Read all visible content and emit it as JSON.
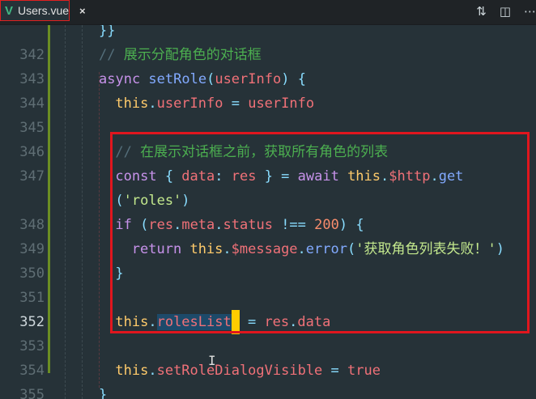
{
  "tab": {
    "icon": "vue-icon",
    "filename": "Users.vue",
    "close": "×"
  },
  "actions": [
    {
      "name": "compare-changes-icon",
      "glyph": "⇅"
    },
    {
      "name": "split-editor-icon",
      "glyph": "◫"
    },
    {
      "name": "more-icon",
      "glyph": "⋯"
    }
  ],
  "current_line": "352",
  "lines": [
    {
      "n": "",
      "indent": 0,
      "t": [
        [
          "pn",
          "}}"
        ]
      ]
    },
    {
      "n": "342",
      "indent": 0,
      "t": [
        [
          "cms",
          "// "
        ],
        [
          "cm",
          "展示分配角色的对话框"
        ]
      ]
    },
    {
      "n": "343",
      "indent": 0,
      "t": [
        [
          "kw",
          "async "
        ],
        [
          "fn",
          "setRole"
        ],
        [
          "pn",
          "("
        ],
        [
          "var",
          "userInfo"
        ],
        [
          "pn",
          ") {"
        ]
      ]
    },
    {
      "n": "344",
      "indent": 2,
      "t": [
        [
          "this",
          "this"
        ],
        [
          "pn",
          "."
        ],
        [
          "var",
          "userInfo"
        ],
        [
          "pn",
          " = "
        ],
        [
          "var",
          "userInfo"
        ]
      ]
    },
    {
      "n": "345",
      "indent": 0,
      "t": []
    },
    {
      "n": "346",
      "indent": 2,
      "t": [
        [
          "cms",
          "// "
        ],
        [
          "cm",
          "在展示对话框之前，获取所有角色的列表"
        ]
      ]
    },
    {
      "n": "347",
      "indent": 2,
      "t": [
        [
          "kw",
          "const "
        ],
        [
          "pn",
          "{ "
        ],
        [
          "var",
          "data"
        ],
        [
          "pn",
          ": "
        ],
        [
          "var",
          "res"
        ],
        [
          "pn",
          " } = "
        ],
        [
          "kw",
          "await "
        ],
        [
          "this",
          "this"
        ],
        [
          "pn",
          "."
        ],
        [
          "var",
          "$http"
        ],
        [
          "pn",
          "."
        ],
        [
          "fn",
          "get"
        ]
      ]
    },
    {
      "n": "",
      "indent": 2,
      "t": [
        [
          "pn",
          "("
        ],
        [
          "str",
          "'roles'"
        ],
        [
          "pn",
          ")"
        ]
      ]
    },
    {
      "n": "348",
      "indent": 2,
      "t": [
        [
          "kw",
          "if "
        ],
        [
          "pn",
          "("
        ],
        [
          "var",
          "res"
        ],
        [
          "pn",
          "."
        ],
        [
          "var",
          "meta"
        ],
        [
          "pn",
          "."
        ],
        [
          "var",
          "status"
        ],
        [
          "pn",
          " !== "
        ],
        [
          "num",
          "200"
        ],
        [
          "pn",
          ") {"
        ]
      ]
    },
    {
      "n": "349",
      "indent": 4,
      "t": [
        [
          "kw",
          "return "
        ],
        [
          "this",
          "this"
        ],
        [
          "pn",
          "."
        ],
        [
          "var",
          "$message"
        ],
        [
          "pn",
          "."
        ],
        [
          "fn",
          "error"
        ],
        [
          "pn",
          "("
        ],
        [
          "str",
          "'获取角色列表失败！'"
        ],
        [
          "pn",
          ")"
        ]
      ]
    },
    {
      "n": "350",
      "indent": 2,
      "t": [
        [
          "pn",
          "}"
        ]
      ]
    },
    {
      "n": "351",
      "indent": 0,
      "t": []
    },
    {
      "n": "352",
      "indent": 2,
      "t": [
        [
          "this",
          "this"
        ],
        [
          "pn",
          "."
        ],
        [
          "var sel",
          "rolesList"
        ],
        [
          "cursor",
          ""
        ],
        [
          "pn",
          " = "
        ],
        [
          "var",
          "res"
        ],
        [
          "pn",
          "."
        ],
        [
          "var",
          "data"
        ]
      ]
    },
    {
      "n": "353",
      "indent": 0,
      "t": []
    },
    {
      "n": "354",
      "indent": 2,
      "t": [
        [
          "this",
          "this"
        ],
        [
          "pn",
          "."
        ],
        [
          "var",
          "setRoleDialogVisible"
        ],
        [
          "pn",
          " = "
        ],
        [
          "var",
          "true"
        ]
      ]
    },
    {
      "n": "355",
      "indent": 0,
      "t": [
        [
          "pn",
          "}"
        ]
      ]
    }
  ]
}
